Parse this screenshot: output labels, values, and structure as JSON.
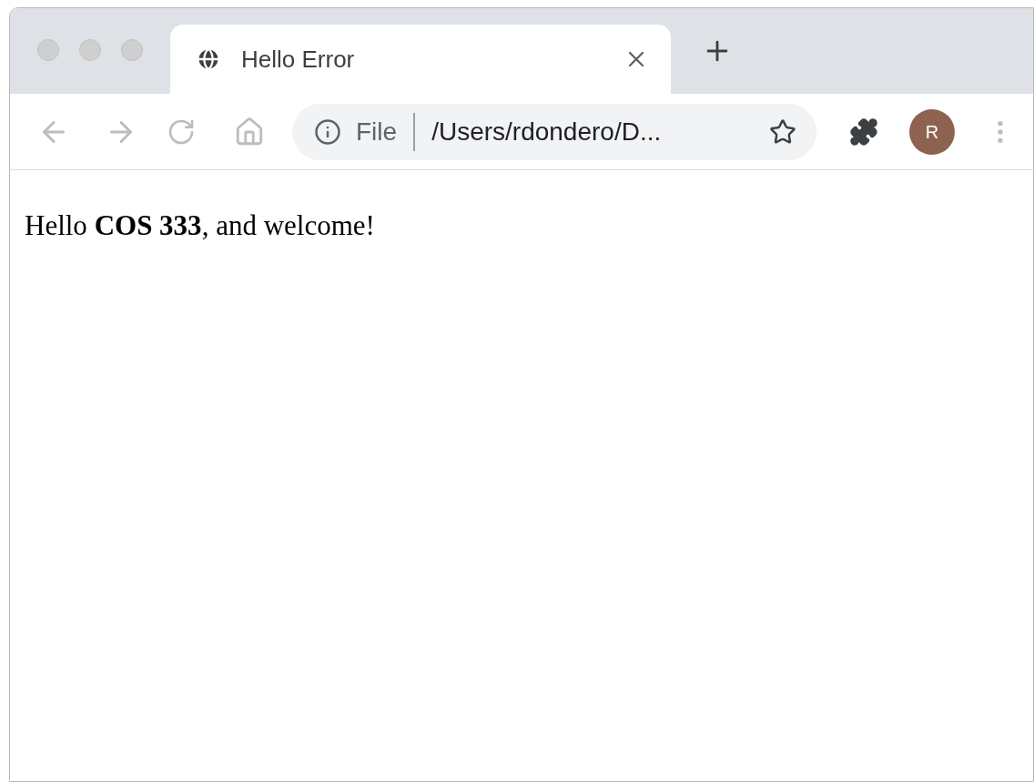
{
  "tabs": [
    {
      "title": "Hello Error",
      "selected": true
    }
  ],
  "toolbar": {
    "address": {
      "scheme": "File",
      "url": "/Users/rdondero/D..."
    },
    "profile": "R"
  },
  "page": {
    "text": "Hello **COS 333**, and welcome!"
  }
}
